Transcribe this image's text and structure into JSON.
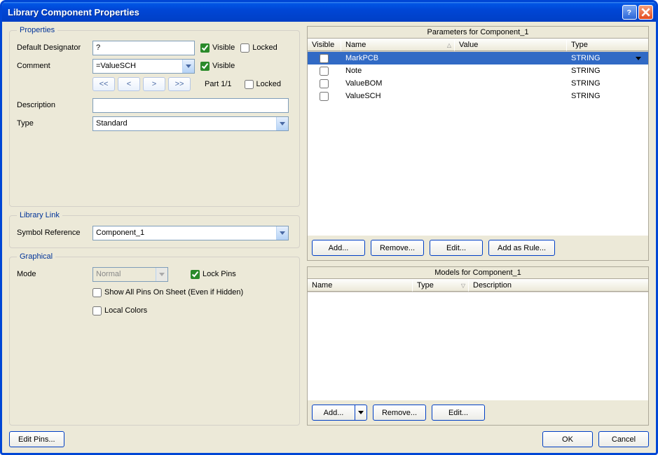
{
  "window": {
    "title": "Library Component Properties"
  },
  "groups": {
    "properties": "Properties",
    "library_link": "Library Link",
    "graphical": "Graphical"
  },
  "properties": {
    "default_designator_label": "Default Designator",
    "default_designator_value": "?",
    "visible_label": "Visible",
    "locked_label": "Locked",
    "designator_visible": true,
    "designator_locked": false,
    "comment_label": "Comment",
    "comment_value": "=ValueSCH",
    "comment_visible": true,
    "part_label": "Part 1/1",
    "part_locked": false,
    "description_label": "Description",
    "description_value": "",
    "type_label": "Type",
    "type_value": "Standard"
  },
  "library_link": {
    "symbol_reference_label": "Symbol Reference",
    "symbol_reference_value": "Component_1"
  },
  "graphical": {
    "mode_label": "Mode",
    "mode_value": "Normal",
    "lock_pins_label": "Lock Pins",
    "lock_pins": true,
    "show_all_pins_label": "Show All Pins On Sheet (Even if Hidden)",
    "show_all_pins": false,
    "local_colors_label": "Local Colors",
    "local_colors": false
  },
  "parameters": {
    "title": "Parameters for Component_1",
    "headers": {
      "visible": "Visible",
      "name": "Name",
      "value": "Value",
      "type": "Type"
    },
    "rows": [
      {
        "visible": false,
        "name": "MarkPCB",
        "value": "",
        "type": "STRING",
        "selected": true
      },
      {
        "visible": false,
        "name": "Note",
        "value": "",
        "type": "STRING",
        "selected": false
      },
      {
        "visible": false,
        "name": "ValueBOM",
        "value": "",
        "type": "STRING",
        "selected": false
      },
      {
        "visible": false,
        "name": "ValueSCH",
        "value": "",
        "type": "STRING",
        "selected": false
      }
    ],
    "buttons": {
      "add": "Add...",
      "remove": "Remove...",
      "edit": "Edit...",
      "add_as_rule": "Add as Rule..."
    }
  },
  "models": {
    "title": "Models for Component_1",
    "headers": {
      "name": "Name",
      "type": "Type",
      "description": "Description"
    },
    "rows": [],
    "buttons": {
      "add": "Add...",
      "remove": "Remove...",
      "edit": "Edit..."
    }
  },
  "footer": {
    "edit_pins": "Edit Pins...",
    "ok": "OK",
    "cancel": "Cancel"
  }
}
